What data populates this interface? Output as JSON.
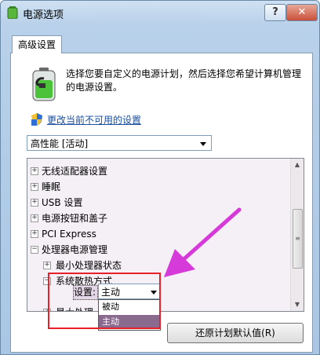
{
  "window": {
    "title": "电源选项",
    "help_label": "?",
    "close_label": "✕"
  },
  "tab": {
    "label": "高级设置"
  },
  "intro": {
    "description": "选择您要自定义的电源计划，然后选择您希望计算机管理的电源设置。",
    "link": "更改当前不可用的设置"
  },
  "plan": {
    "value": "高性能 [活动]"
  },
  "tree": {
    "items": [
      {
        "label": "无线适配器设置",
        "expander": "+"
      },
      {
        "label": "睡眠",
        "expander": "+"
      },
      {
        "label": "USB 设置",
        "expander": "+"
      },
      {
        "label": "电源按钮和盖子",
        "expander": "+"
      },
      {
        "label": "PCI Express",
        "expander": "+"
      },
      {
        "label": "处理器电源管理",
        "expander": "−"
      },
      {
        "label": "最小处理器状态",
        "expander": "+"
      },
      {
        "label": "系统散热方式",
        "expander": "−"
      },
      {
        "label": "最大处理",
        "expander": "+"
      }
    ],
    "setting_label": "设置:",
    "setting_value": "主动",
    "options": [
      "被动",
      "主动"
    ]
  },
  "scrollbar": {
    "up": "▲",
    "down": "▼",
    "grip": "≡"
  },
  "buttons": {
    "restore": "还原计划默认值(R)"
  },
  "colors": {
    "highlight": "#e8202a",
    "arrow": "#d63ad9",
    "selected_option": "#8b6a8f"
  }
}
